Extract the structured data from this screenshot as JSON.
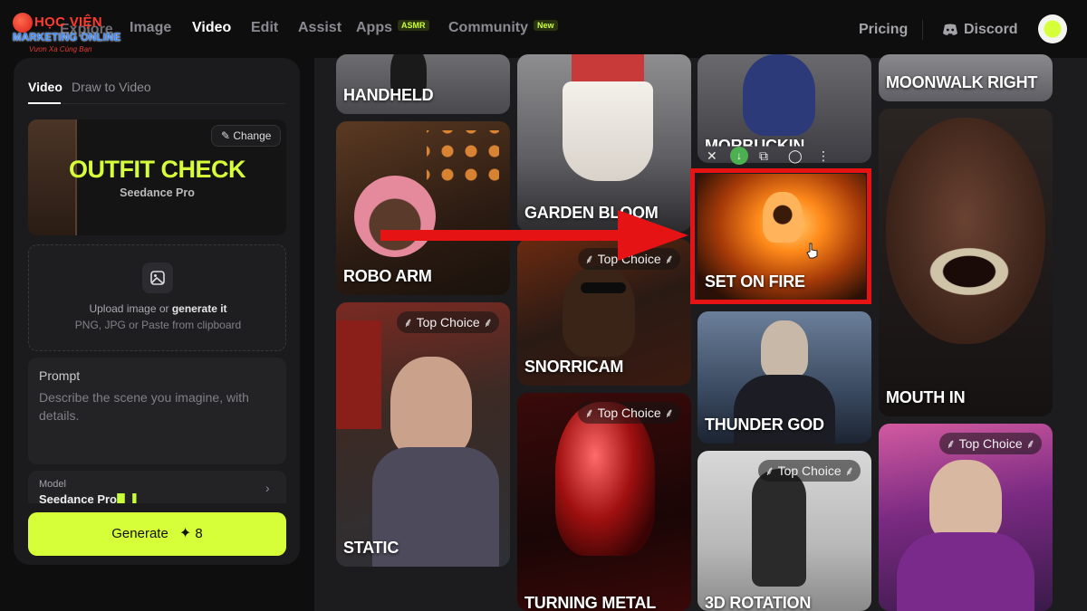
{
  "logo": {
    "line1": "HỌC VIỆN",
    "line2": "MARKETING ONLINE",
    "line3": "Vươn Xa Cùng Bạn"
  },
  "nav": {
    "explore": "Explore",
    "image": "Image",
    "video": "Video",
    "edit": "Edit",
    "assist": "Assist",
    "apps": "Apps",
    "apps_badge": "ASMR",
    "community": "Community",
    "community_badge": "New",
    "pricing": "Pricing",
    "discord": "Discord"
  },
  "panel": {
    "tab_video": "Video",
    "tab_draw": "Draw to Video",
    "hero_title": "OUTFIT CHECK",
    "hero_sub": "Seedance Pro",
    "change": "Change",
    "upload_line1_pre": "Upload image or ",
    "upload_line1_bold": "generate it",
    "upload_line2": "PNG, JPG or Paste from clipboard",
    "prompt_label": "Prompt",
    "prompt_placeholder": "Describe the scene you imagine, with details.",
    "model_label": "Model",
    "model_value": "Seedance Pro",
    "generate": "Generate",
    "generate_cost": "8"
  },
  "gallery": {
    "top_choice": "Top Choice",
    "cards": {
      "handheld": "HANDHELD",
      "robo_arm": "ROBO ARM",
      "static": "STATIC",
      "garden_bloom": "GARDEN BLOOM",
      "snorricam": "SNORRICAM",
      "turning_metal": "TURNING METAL",
      "morbuckin": "MORBUCKIN",
      "set_on_fire": "SET ON FIRE",
      "thunder_god": "THUNDER GOD",
      "rotation_3d": "3D ROTATION",
      "moonwalk_right": "MOONWALK RIGHT",
      "mouth_in": "MOUTH IN"
    }
  },
  "colors": {
    "accent": "#d6ff3a",
    "highlight": "#e51313",
    "arrow": "#e51313"
  }
}
